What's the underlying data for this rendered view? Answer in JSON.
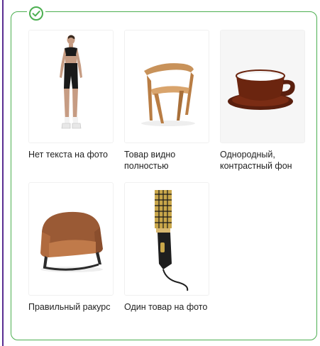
{
  "colors": {
    "accent": "#4caf50",
    "text": "#222222",
    "left_rule": "#5a2d91"
  },
  "header": {
    "check_icon": "check-circle-icon"
  },
  "items": [
    {
      "caption": "Нет текста на фото",
      "icon": "woman-in-sportswear-image"
    },
    {
      "caption": "Товар видно полностью",
      "icon": "wooden-chair-image"
    },
    {
      "caption": "Однородный, контрастный фон",
      "icon": "coffee-cup-image"
    },
    {
      "caption": "Правильный ракурс",
      "icon": "leather-armchair-image"
    },
    {
      "caption": "Один товар на фото",
      "icon": "hair-dryer-brush-image"
    }
  ]
}
